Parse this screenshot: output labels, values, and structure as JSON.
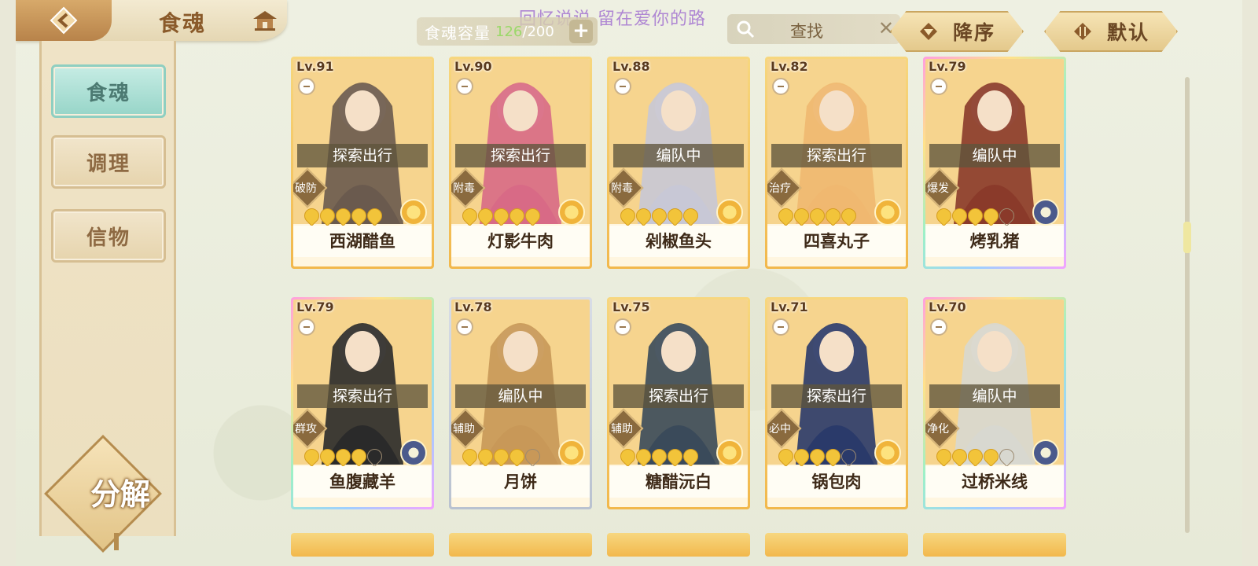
{
  "header": {
    "tab_title": "食魂",
    "watermark": "回忆说说 留在爱你的路",
    "capacity": {
      "label": "食魂容量",
      "current": "126",
      "separator": "/",
      "max": "200"
    },
    "search": {
      "text": "查找"
    },
    "sort_order_label": "降序",
    "sort_mode_label": "默认"
  },
  "sidebar": {
    "items": [
      {
        "label": "食魂",
        "active": true
      },
      {
        "label": "调理",
        "active": false
      },
      {
        "label": "信物",
        "active": false
      }
    ],
    "decompose_label": "分解"
  },
  "cards": [
    {
      "level": "Lv.91",
      "status": "探索出行",
      "role": "破防",
      "name": "西湖醋鱼",
      "stars": 5,
      "medal": "gold",
      "rarity": "gold"
    },
    {
      "level": "Lv.90",
      "status": "探索出行",
      "role": "附毒",
      "name": "灯影牛肉",
      "stars": 5,
      "medal": "gold",
      "rarity": "gold"
    },
    {
      "level": "Lv.88",
      "status": "编队中",
      "role": "附毒",
      "name": "剁椒鱼头",
      "stars": 5,
      "medal": "gold",
      "rarity": "gold"
    },
    {
      "level": "Lv.82",
      "status": "探索出行",
      "role": "治疗",
      "name": "四喜丸子",
      "stars": 5,
      "medal": "gold",
      "rarity": "gold"
    },
    {
      "level": "Lv.79",
      "status": "编队中",
      "role": "爆发",
      "name": "烤乳猪",
      "stars": 4,
      "medal": "blue",
      "rarity": "rainbow"
    },
    {
      "level": "Lv.79",
      "status": "探索出行",
      "role": "群攻",
      "name": "鱼腹藏羊",
      "stars": 4,
      "medal": "blue",
      "rarity": "rainbow"
    },
    {
      "level": "Lv.78",
      "status": "编队中",
      "role": "辅助",
      "name": "月饼",
      "stars": 4,
      "medal": "gold",
      "rarity": "silver"
    },
    {
      "level": "Lv.75",
      "status": "探索出行",
      "role": "辅助",
      "name": "糖醋沅白",
      "stars": 5,
      "medal": "gold",
      "rarity": "gold"
    },
    {
      "level": "Lv.71",
      "status": "探索出行",
      "role": "必中",
      "name": "锅包肉",
      "stars": 4,
      "medal": "gold",
      "rarity": "gold"
    },
    {
      "level": "Lv.70",
      "status": "编队中",
      "role": "净化",
      "name": "过桥米线",
      "stars": 4,
      "medal": "blue",
      "rarity": "rainbow"
    }
  ],
  "colors": {
    "accent_teal": "#97d5c8",
    "gold": "#f2b84c",
    "brown_text": "#6b4724"
  }
}
